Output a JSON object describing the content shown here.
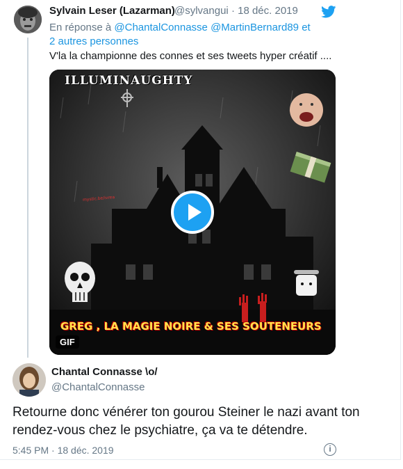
{
  "tweet1": {
    "author_name": "Sylvain Leser (Lazarman)",
    "handle": "@sylvangui",
    "separator": "·",
    "date": "18 déc. 2019",
    "reply_prefix": "En réponse à",
    "reply_mention1": "@ChantalConnasse",
    "reply_mention2": "@MartinBernard89",
    "reply_suffix": "et 2 autres personnes",
    "text": "V'la la championne des connes et ses tweets hyper créatif ....",
    "media": {
      "overlay_title": "ILLUMINAUGHTY",
      "overlay_caption": "GREG , LA MAGIE NOIRE & SES SOUTENEURS",
      "badge": "GIF"
    }
  },
  "tweet2": {
    "author_name": "Chantal Connasse \\o/",
    "handle": "@ChantalConnasse",
    "text": "Retourne donc vénérer ton gourou Steiner le nazi avant ton rendez-vous chez le psychiatre, ça va te détendre.",
    "timestamp": "5:45 PM · 18 déc. 2019"
  },
  "icons": {
    "brand": "twitter-bird-icon",
    "play": "play-icon",
    "info": "info-icon"
  },
  "colors": {
    "accent": "#1da1f2",
    "link": "#1b95e0",
    "secondary_text": "#657786",
    "primary_text": "#14171a"
  }
}
